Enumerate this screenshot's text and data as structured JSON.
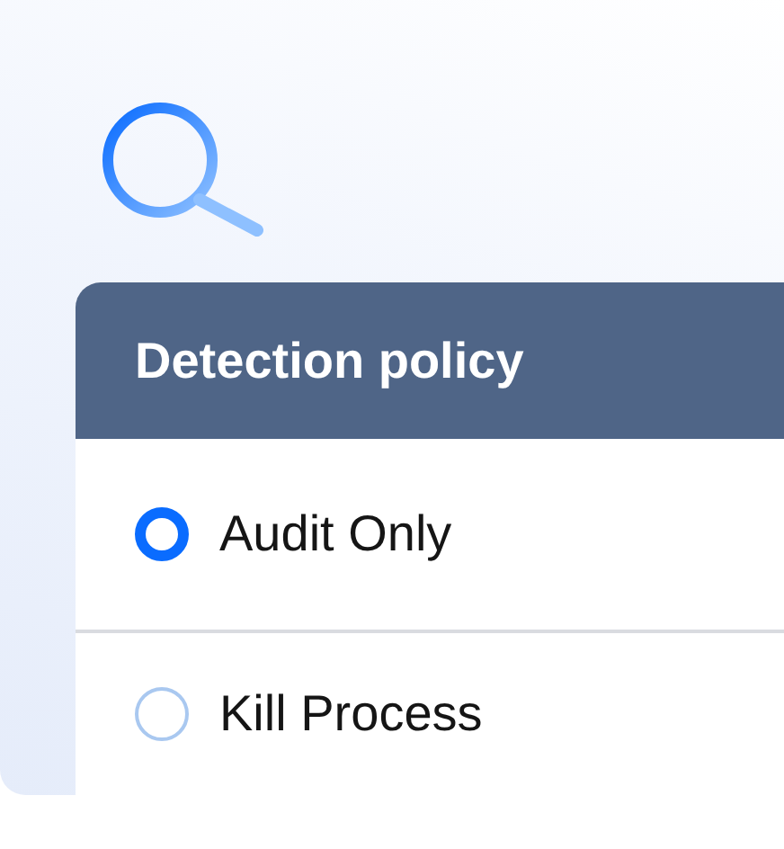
{
  "panel": {
    "title": "Detection policy"
  },
  "options": [
    {
      "label": "Audit Only",
      "selected": true
    },
    {
      "label": "Kill Process",
      "selected": false
    }
  ]
}
